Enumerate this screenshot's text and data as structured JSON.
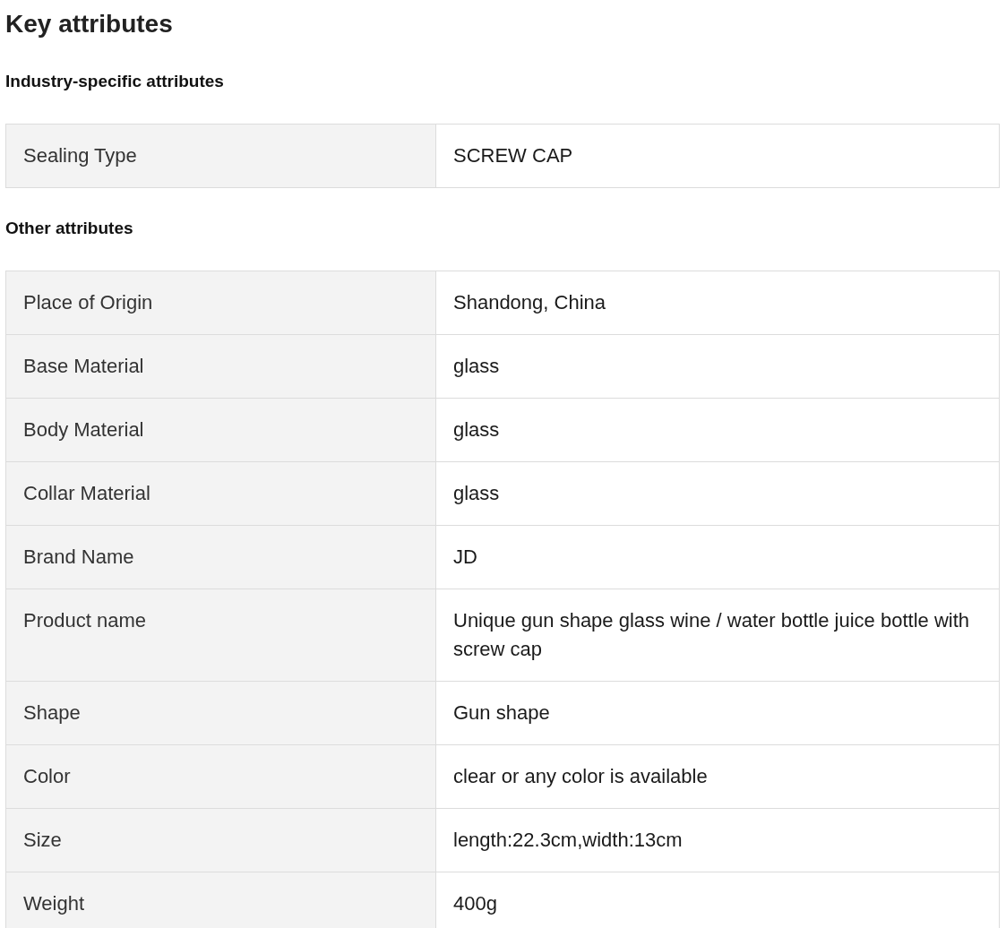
{
  "title": "Key attributes",
  "sections": [
    {
      "heading": "Industry-specific attributes",
      "rows": [
        {
          "label": "Sealing Type",
          "value": "SCREW CAP"
        }
      ]
    },
    {
      "heading": "Other attributes",
      "rows": [
        {
          "label": "Place of Origin",
          "value": "Shandong, China"
        },
        {
          "label": "Base Material",
          "value": "glass"
        },
        {
          "label": "Body Material",
          "value": "glass"
        },
        {
          "label": "Collar Material",
          "value": "glass"
        },
        {
          "label": "Brand Name",
          "value": "JD"
        },
        {
          "label": "Product name",
          "value": "Unique gun shape glass wine / water bottle juice bottle with screw cap"
        },
        {
          "label": "Shape",
          "value": "Gun shape"
        },
        {
          "label": "Color",
          "value": "clear or any color is available"
        },
        {
          "label": "Size",
          "value": "length:22.3cm,width:13cm"
        },
        {
          "label": "Weight",
          "value": "400g"
        }
      ]
    }
  ]
}
